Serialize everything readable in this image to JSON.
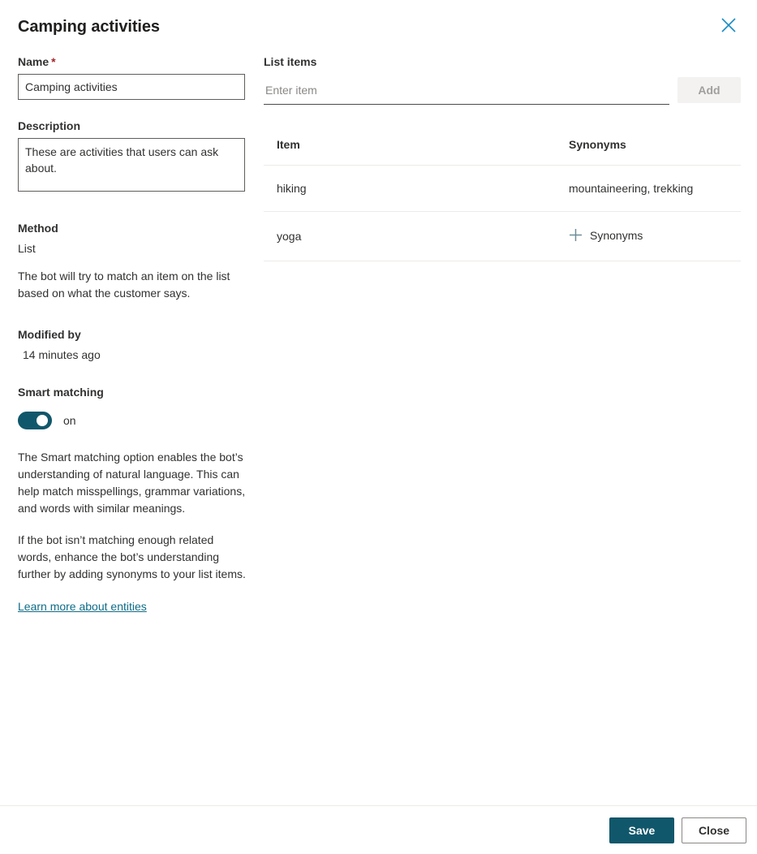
{
  "header": {
    "title": "Camping activities",
    "close_icon": "close-icon"
  },
  "form": {
    "name": {
      "label": "Name",
      "required_marker": "*",
      "value": "Camping activities",
      "placeholder": ""
    },
    "description": {
      "label": "Description",
      "value": "These are activities that users can ask about.",
      "placeholder": ""
    },
    "method": {
      "label": "Method",
      "value": "List",
      "help": "The bot will try to match an item on the list based on what the customer says."
    },
    "modified_by": {
      "label": "Modified by",
      "value": "14 minutes ago"
    },
    "smart_matching": {
      "label": "Smart matching",
      "state_label": "on",
      "enabled": true,
      "paragraph_1": "The Smart matching option enables the bot’s understanding of natural language. This can help match misspellings, grammar variations, and words with similar meanings.",
      "paragraph_2": "If the bot isn’t matching enough related words, enhance the bot’s understanding further by adding synonyms to your list items.",
      "link_text": "Learn more about entities"
    }
  },
  "list_items": {
    "label": "List items",
    "input_value": "",
    "input_placeholder": "Enter item",
    "add_button_label": "Add",
    "add_button_disabled": true,
    "columns": {
      "item": "Item",
      "synonyms": "Synonyms"
    },
    "rows": [
      {
        "item": "hiking",
        "synonyms": "mountaineering, trekking",
        "has_synonyms": true,
        "add_synonyms_label": ""
      },
      {
        "item": "yoga",
        "synonyms": "",
        "has_synonyms": false,
        "add_synonyms_label": "Synonyms"
      }
    ]
  },
  "footer": {
    "save_label": "Save",
    "close_label": "Close"
  },
  "colors": {
    "accent_teal": "#11576b",
    "link_teal": "#0f6c87",
    "close_blue": "#1a8cc4",
    "plus_icon": "#6b8e97",
    "required_red": "#a4262c",
    "disabled_text": "#a19f9d",
    "disabled_bg": "#f3f2f1",
    "divider": "#edebe9",
    "text": "#323130"
  }
}
